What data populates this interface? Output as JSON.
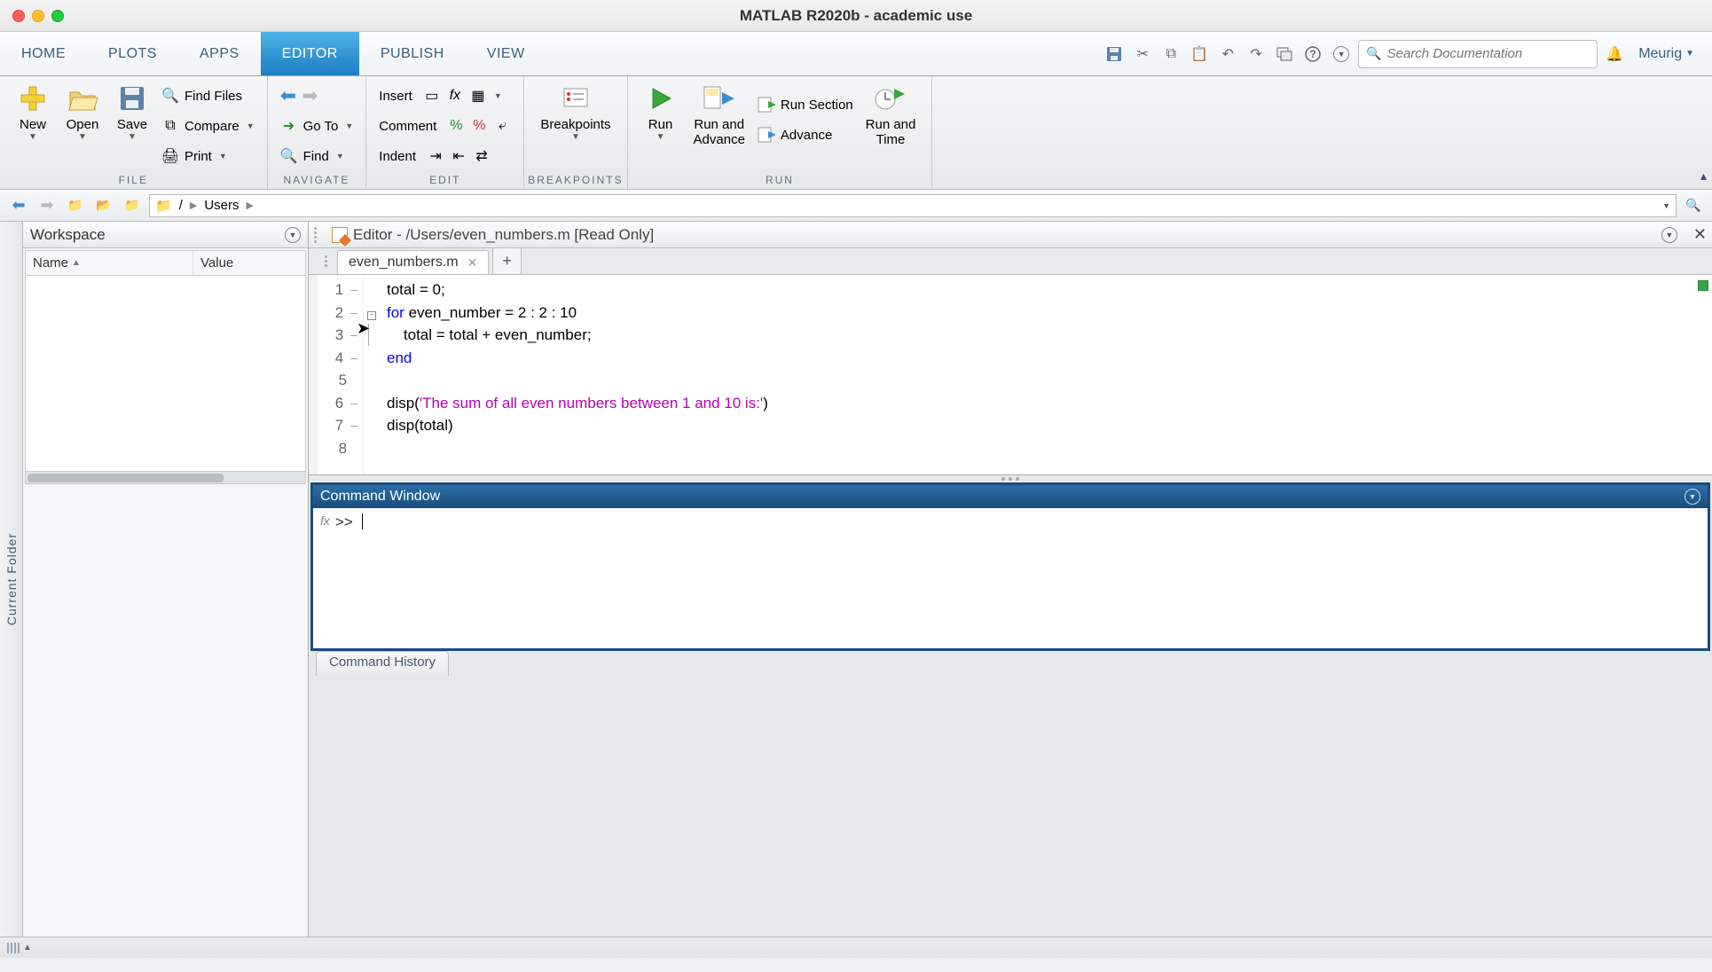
{
  "window": {
    "title": "MATLAB R2020b - academic use"
  },
  "tabs": {
    "home": "HOME",
    "plots": "PLOTS",
    "apps": "APPS",
    "editor": "EDITOR",
    "publish": "PUBLISH",
    "view": "VIEW"
  },
  "search": {
    "placeholder": "Search Documentation"
  },
  "username": "Meurig",
  "toolstrip": {
    "file": {
      "label": "FILE",
      "new": "New",
      "open": "Open",
      "save": "Save",
      "findfiles": "Find Files",
      "compare": "Compare",
      "print": "Print"
    },
    "navigate": {
      "label": "NAVIGATE",
      "goto": "Go To",
      "find": "Find"
    },
    "edit": {
      "label": "EDIT",
      "insert": "Insert",
      "comment": "Comment",
      "indent": "Indent"
    },
    "breakpoints": {
      "label": "BREAKPOINTS",
      "breakpoints": "Breakpoints"
    },
    "run": {
      "label": "RUN",
      "run": "Run",
      "runadvance": "Run and\nAdvance",
      "runsection": "Run Section",
      "advance": "Advance",
      "runtime": "Run and\nTime"
    }
  },
  "path": {
    "root": "/",
    "seg1": "Users"
  },
  "sidebar_tab": "Current Folder",
  "workspace": {
    "title": "Workspace",
    "col_name": "Name",
    "col_value": "Value"
  },
  "editor": {
    "title": "Editor - /Users/even_numbers.m  [Read Only]",
    "filename": "even_numbers.m",
    "code": {
      "l1": "total = 0;",
      "l2a": "for",
      "l2b": " even_number = 2 : 2 : 10",
      "l3": "    total = total + even_number;",
      "l4": "end",
      "l5": "",
      "l6a": "disp(",
      "l6b": "'The sum of all even numbers between 1 and 10 is:'",
      "l6c": ")",
      "l7": "disp(total)",
      "l8": ""
    }
  },
  "cmdwin": {
    "title": "Command Window",
    "prompt": ">>"
  },
  "cmdhist": {
    "title": "Command History"
  }
}
